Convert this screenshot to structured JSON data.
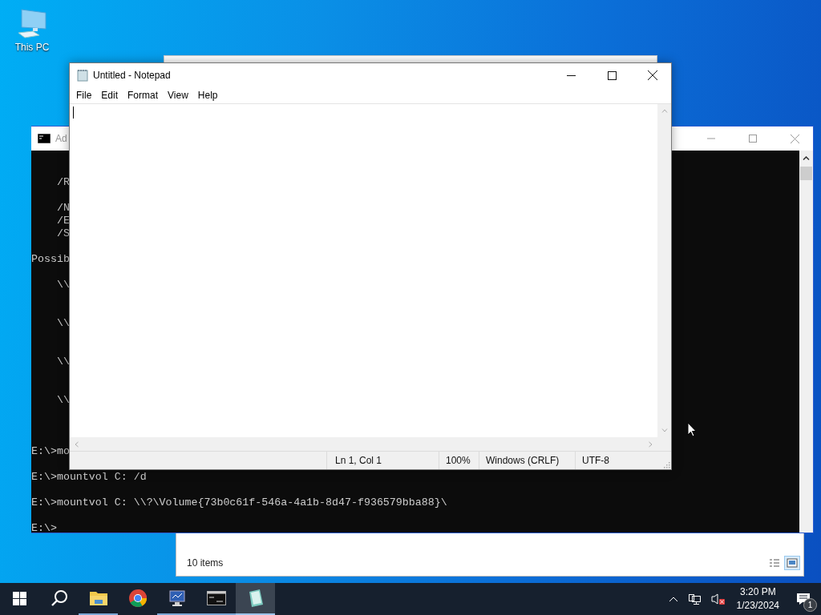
{
  "desktop_icons": [
    {
      "label": "This PC"
    }
  ],
  "explorer": {
    "status": "10 items",
    "views": [
      {
        "selected": false
      },
      {
        "selected": true
      }
    ]
  },
  "console": {
    "title": "Ad",
    "lines": [
      "    /R",
      "    /N",
      "    /E",
      "    /S",
      "Possib",
      "    \\\\",
      "    \\\\",
      "    \\\\",
      "    \\\\",
      "E:\\>mo",
      "E:\\>mountvol C: /d",
      "E:\\>mountvol C: \\\\?\\Volume{73b0c61f-546a-4a1b-8d47-f936579bba88}\\",
      "E:\\>"
    ]
  },
  "notepad": {
    "title": "Untitled - Notepad",
    "menu": [
      "File",
      "Edit",
      "Format",
      "View",
      "Help"
    ],
    "status": [
      "Ln 1, Col 1",
      "100%",
      "Windows (CRLF)",
      "UTF-8"
    ]
  },
  "taskbar": {
    "apps": [
      {
        "kind": "explorer",
        "running": true,
        "selected": false
      },
      {
        "kind": "chrome",
        "running": false,
        "selected": false
      },
      {
        "kind": "monitor",
        "running": true,
        "selected": false
      },
      {
        "kind": "console",
        "running": true,
        "selected": false
      },
      {
        "kind": "notepad",
        "running": true,
        "selected": true
      }
    ],
    "time": "3:20 PM",
    "date": "1/23/2024",
    "notifications": "1"
  }
}
